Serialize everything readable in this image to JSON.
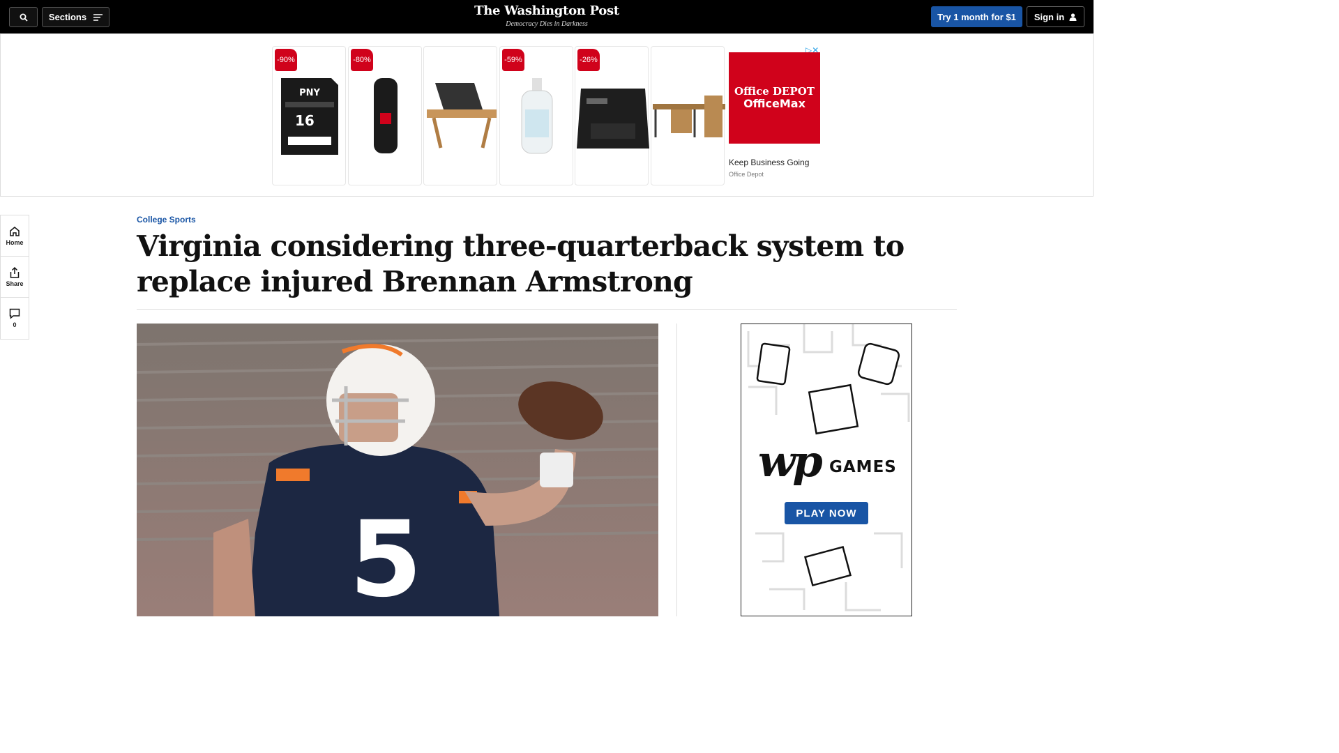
{
  "header": {
    "sections_label": "Sections",
    "logo": "The Washington Post",
    "tagline": "Democracy Dies in Darkness",
    "try_label": "Try 1 month for $1",
    "signin_label": "Sign in"
  },
  "ad": {
    "products": [
      {
        "discount": "-90%",
        "icon": "sd-card-icon"
      },
      {
        "discount": "-80%",
        "icon": "usb-drive-icon"
      },
      {
        "discount": "",
        "icon": "laptop-desk-icon"
      },
      {
        "discount": "-59%",
        "icon": "hand-sanitizer-icon"
      },
      {
        "discount": "-26%",
        "icon": "printer-icon"
      },
      {
        "discount": "",
        "icon": "office-desk-icon"
      }
    ],
    "sd_brand": "PNY",
    "sd_size": "16",
    "brand_line1": "Office DEPOT",
    "brand_line2": "OfficeMax",
    "title": "Keep Business Going",
    "advertiser": "Office Depot",
    "accent": "#d0021b"
  },
  "rail": {
    "home_label": "Home",
    "share_label": "Share",
    "comments_count": "0"
  },
  "article": {
    "kicker": "College Sports",
    "headline": "Virginia considering three-quarterback system to replace injured Brennan Armstrong",
    "jersey_number": "5"
  },
  "games_ad": {
    "label": "GAMES",
    "mark": "wp",
    "play_label": "PLAY NOW",
    "accent": "#1955a5"
  }
}
